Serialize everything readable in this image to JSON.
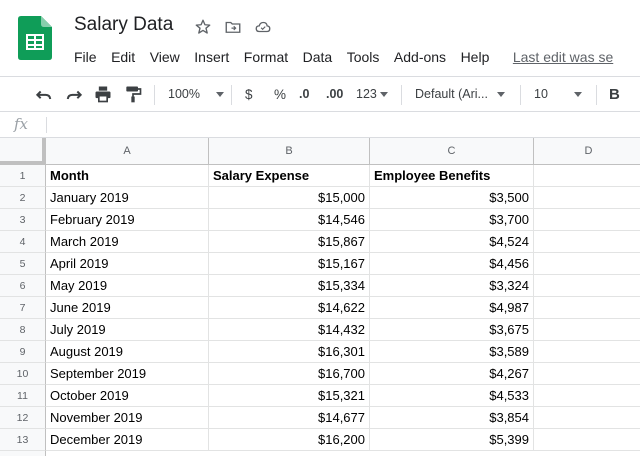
{
  "app": {
    "doc_title": "Salary Data",
    "menu": [
      "File",
      "Edit",
      "View",
      "Insert",
      "Format",
      "Data",
      "Tools",
      "Add-ons",
      "Help"
    ],
    "last_edit": "Last edit was se"
  },
  "toolbar": {
    "zoom": "100%",
    "currency": "$",
    "percent": "%",
    "decrease_decimals": ".0",
    "increase_decimals": ".00",
    "more_formats": "123",
    "font": "Default (Ari...",
    "font_size": "10",
    "bold": "B"
  },
  "formula_bar": {
    "fx": "fx",
    "value": ""
  },
  "sheet": {
    "columns": [
      "A",
      "B",
      "C",
      "D"
    ],
    "rows": [
      [
        "Month",
        "Salary Expense",
        "Employee Benefits",
        ""
      ],
      [
        "January 2019",
        "$15,000",
        "$3,500",
        ""
      ],
      [
        "February 2019",
        "$14,546",
        "$3,700",
        ""
      ],
      [
        "March 2019",
        "$15,867",
        "$4,524",
        ""
      ],
      [
        "April 2019",
        "$15,167",
        "$4,456",
        ""
      ],
      [
        "May 2019",
        "$15,334",
        "$3,324",
        ""
      ],
      [
        "June 2019",
        "$14,622",
        "$4,987",
        ""
      ],
      [
        "July 2019",
        "$14,432",
        "$3,675",
        ""
      ],
      [
        "August 2019",
        "$16,301",
        "$3,589",
        ""
      ],
      [
        "September 2019",
        "$16,700",
        "$4,267",
        ""
      ],
      [
        "October 2019",
        "$15,321",
        "$4,533",
        ""
      ],
      [
        "November 2019",
        "$14,677",
        "$3,854",
        ""
      ],
      [
        "December 2019",
        "$16,200",
        "$5,399",
        ""
      ]
    ]
  },
  "colors": {
    "sheets_green": "#0f9d58",
    "header_bg": "#f8f9fa",
    "grid_line": "#e2e3e3"
  }
}
